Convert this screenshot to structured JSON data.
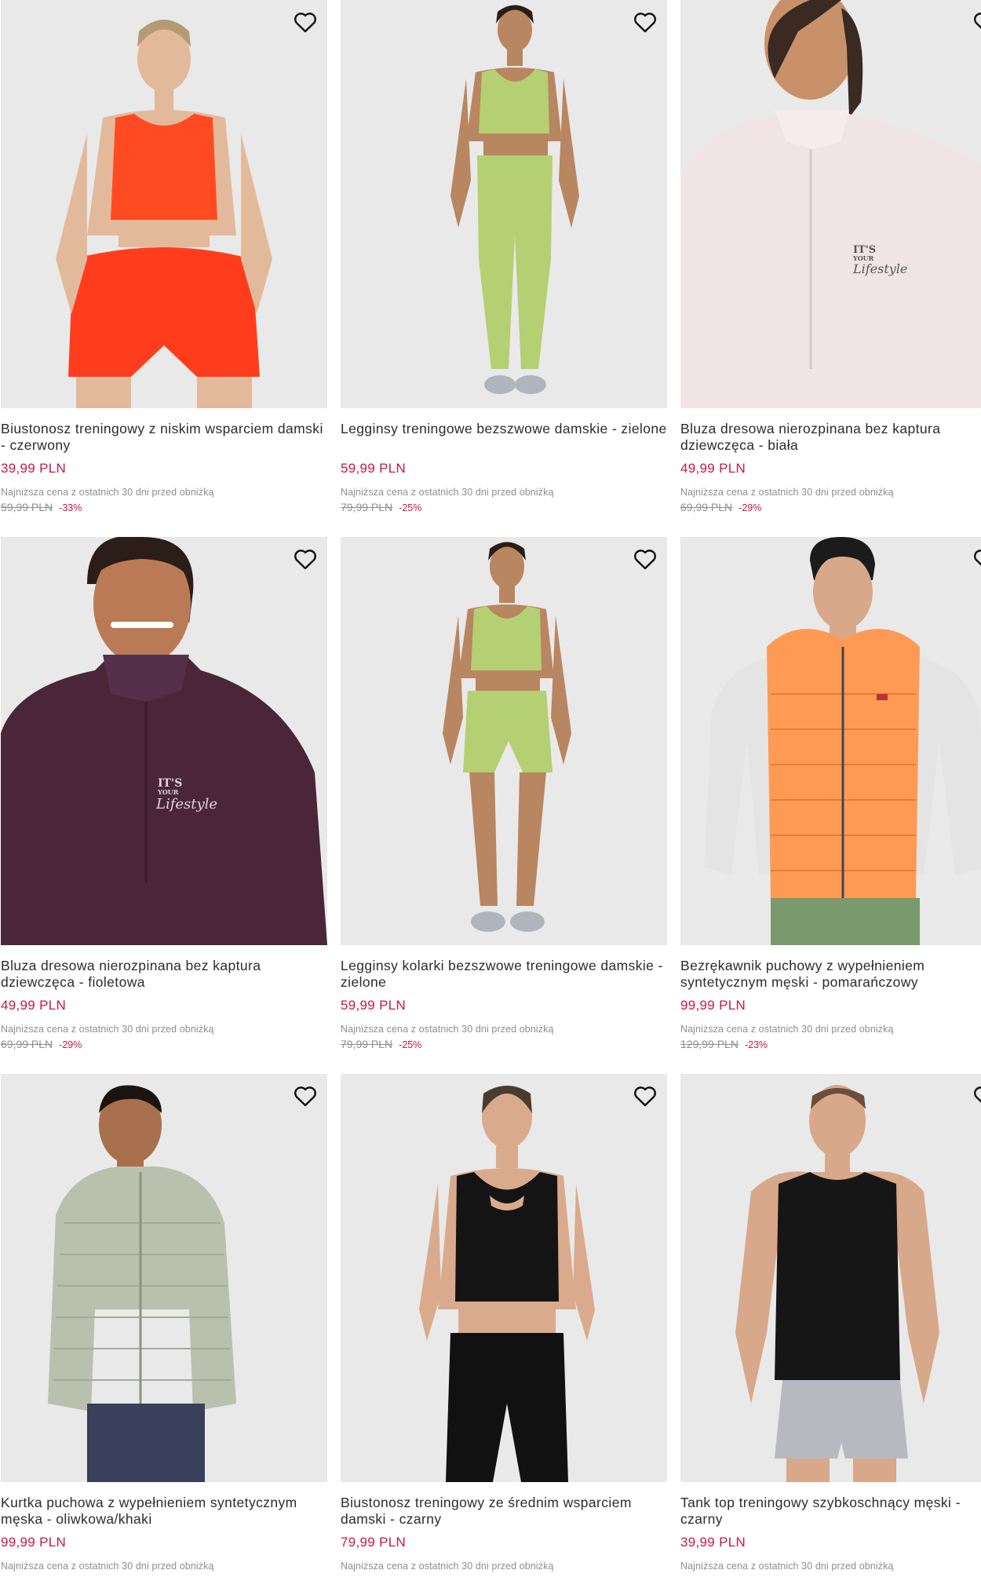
{
  "lowest_label": "Najniższa cena z ostatnich 30 dni przed obniżką",
  "colors": {
    "price": "#c8174a",
    "muted": "#8e8e8e",
    "image_bg": "#e9e9e9"
  },
  "products": [
    {
      "title": "Biustonosz treningowy z niskim wsparciem damski - czerwony",
      "price": "39,99 PLN",
      "old_price": "59,99 PLN",
      "discount": "-33%",
      "wishlist_icon": "heart-outline-icon"
    },
    {
      "title": "Legginsy treningowe bezszwowe damskie - zielone",
      "price": "59,99 PLN",
      "old_price": "79,99 PLN",
      "discount": "-25%",
      "wishlist_icon": "heart-outline-icon"
    },
    {
      "title": "Bluza dresowa nierozpinana bez kaptura dziewczęca - biała",
      "price": "49,99 PLN",
      "old_price": "69,99 PLN",
      "discount": "-29%",
      "wishlist_icon": "heart-outline-icon"
    },
    {
      "title": "Bluza dresowa nierozpinana bez kaptura dziewczęca - fioletowa",
      "price": "49,99 PLN",
      "old_price": "69,99 PLN",
      "discount": "-29%",
      "wishlist_icon": "heart-outline-icon"
    },
    {
      "title": "Legginsy kolarki bezszwowe treningowe damskie - zielone",
      "price": "59,99 PLN",
      "old_price": "79,99 PLN",
      "discount": "-25%",
      "wishlist_icon": "heart-outline-icon"
    },
    {
      "title": "Bezrękawnik puchowy z wypełnieniem syntetycznym męski - pomarańczowy",
      "price": "99,99 PLN",
      "old_price": "129,99 PLN",
      "discount": "-23%",
      "wishlist_icon": "heart-outline-icon"
    },
    {
      "title": "Kurtka puchowa z wypełnieniem syntetycznym męska - oliwkowa/khaki",
      "price": "99,99 PLN",
      "old_price": "",
      "discount": "",
      "wishlist_icon": "heart-outline-icon"
    },
    {
      "title": "Biustonosz treningowy ze średnim wsparciem damski - czarny",
      "price": "79,99 PLN",
      "old_price": "",
      "discount": "",
      "wishlist_icon": "heart-outline-icon"
    },
    {
      "title": "Tank top treningowy szybkoschnący męski - czarny",
      "price": "39,99 PLN",
      "old_price": "",
      "discount": "",
      "wishlist_icon": "heart-outline-icon"
    }
  ]
}
